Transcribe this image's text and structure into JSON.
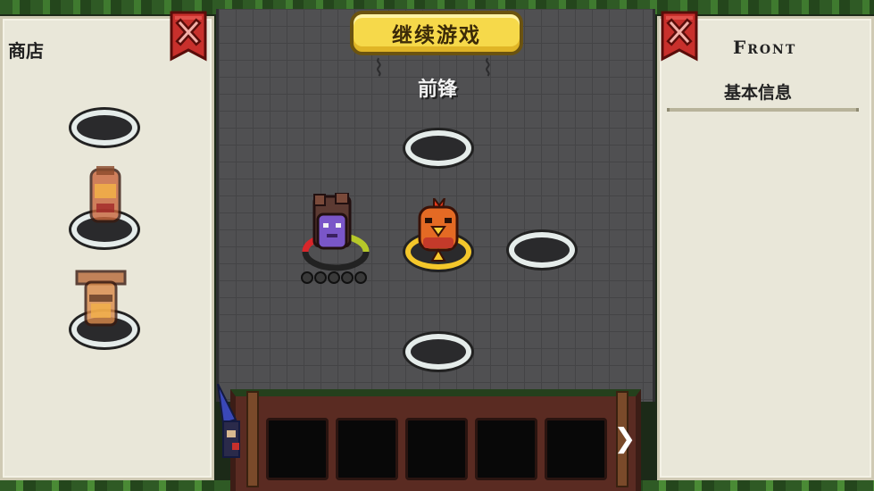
{
  "shop": {
    "title": "商店"
  },
  "board": {
    "continue_label": "继续游戏",
    "position_label": "前锋"
  },
  "info": {
    "title": "Front",
    "basic_info_label": "基本信息"
  },
  "hero": {
    "health_pips": 5
  },
  "bench": {
    "slot_count": 5
  },
  "icons": {
    "close": "close-x-icon",
    "next": "chevron-right-icon"
  },
  "colors": {
    "continue_button": "#f6d94a",
    "close_banner": "#c8302c",
    "parchment": "#e9e7d9",
    "board": "#505052"
  }
}
